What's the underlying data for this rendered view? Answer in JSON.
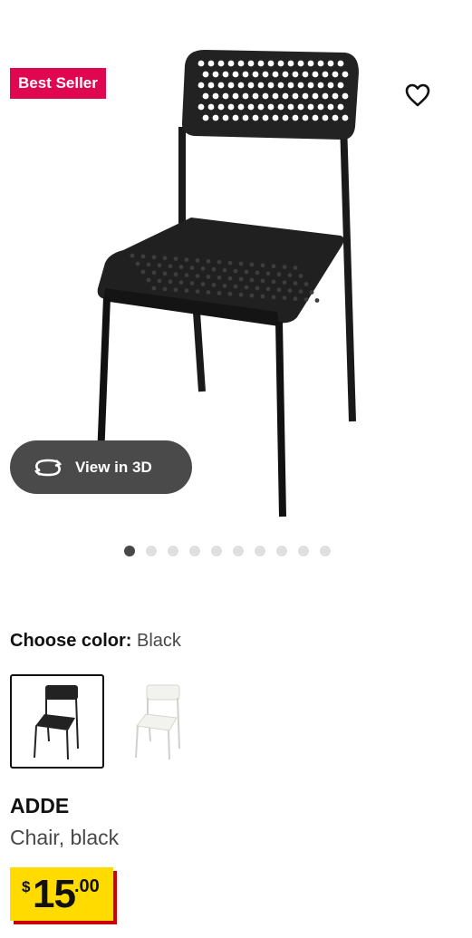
{
  "product": {
    "badge": "Best Seller",
    "name": "ADDE",
    "description": "Chair, black",
    "price": {
      "currency": "$",
      "integer": "15",
      "decimal": ".00"
    }
  },
  "gallery": {
    "view_3d_label": "View in 3D",
    "image_count": 10,
    "active_index": 0
  },
  "color": {
    "label": "Choose color:",
    "selected": "Black",
    "options": [
      "Black",
      "White"
    ]
  },
  "icons": {
    "favorite": "heart-outline-icon",
    "view3d": "rotate-3d-icon"
  },
  "colors": {
    "badge_bg": "#e00751",
    "price_bg": "#ffdb00",
    "price_shadow": "#cc0008",
    "pill_bg": "#4a4a4a"
  }
}
